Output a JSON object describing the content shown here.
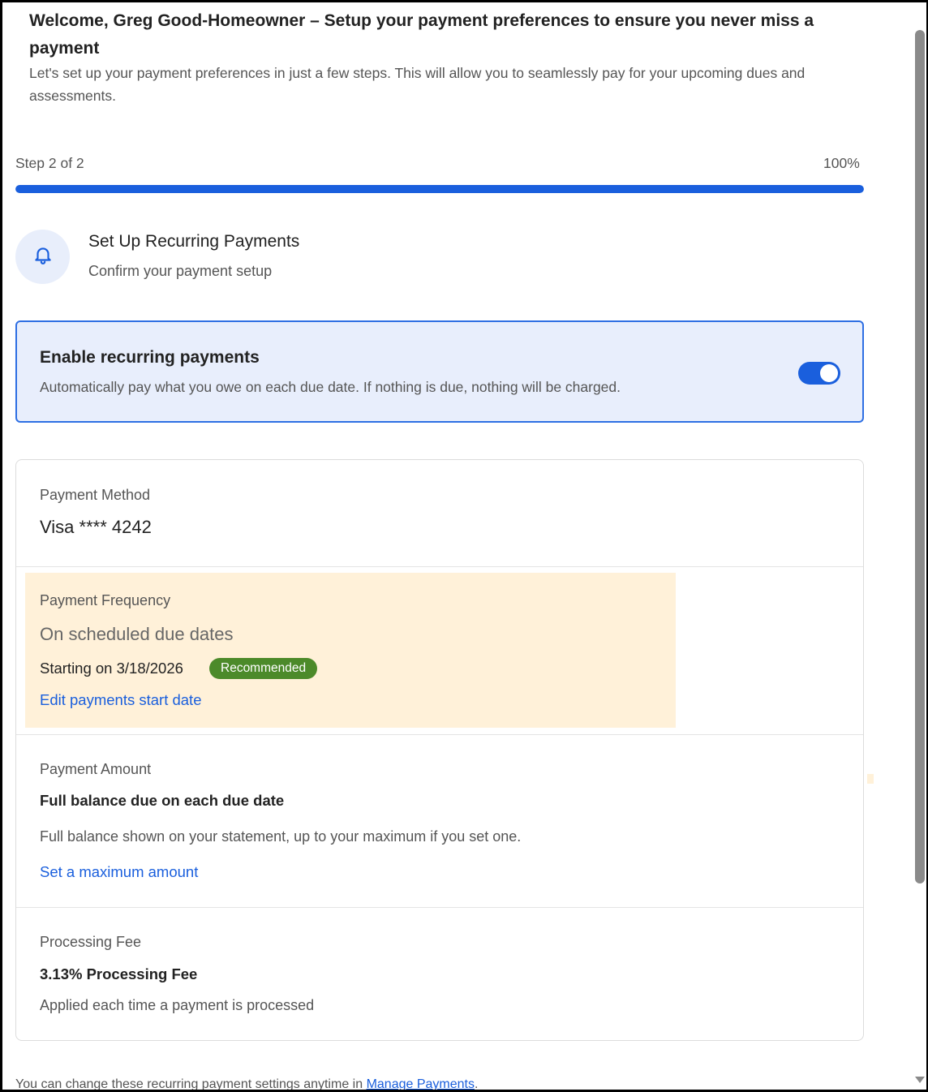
{
  "header": {
    "title": "Welcome, Greg Good-Homeowner – Setup your payment preferences to ensure you never miss a payment",
    "subtitle": "Let's set up your payment preferences in just a few steps. This will allow you to seamlessly pay for your upcoming dues and assessments."
  },
  "progress": {
    "step_label": "Step 2 of 2",
    "percent_label": "100%",
    "fraction": 1.0,
    "bar_color": "#1a5fdd"
  },
  "section": {
    "icon": "bell-icon",
    "title": "Set Up Recurring Payments",
    "subtitle": "Confirm your payment setup"
  },
  "recurring": {
    "title": "Enable recurring payments",
    "description": "Automatically pay what you owe on each due date. If nothing is due, nothing will be charged.",
    "enabled": true
  },
  "payment_method": {
    "label": "Payment Method",
    "value": "Visa **** 4242"
  },
  "payment_frequency": {
    "label": "Payment Frequency",
    "value": "On scheduled due dates",
    "start_text": "Starting on 3/18/2026",
    "badge": "Recommended",
    "badge_color": "#4c8a2a",
    "edit_link": "Edit payments start date"
  },
  "payment_amount": {
    "label": "Payment Amount",
    "value": "Full balance due on each due date",
    "note": "Full balance shown on your statement, up to your maximum if you set one.",
    "max_link": "Set a maximum amount"
  },
  "processing_fee": {
    "label": "Processing Fee",
    "value": "3.13% Processing Fee",
    "note": "Applied each time a payment is processed"
  },
  "footer": {
    "text": "You can change these recurring payment settings anytime in",
    "link": "Manage Payments",
    "suffix": "."
  },
  "colors": {
    "accent": "#1a5fdd",
    "highlight": "#fff1d9",
    "card_tint": "#e8eefc"
  }
}
